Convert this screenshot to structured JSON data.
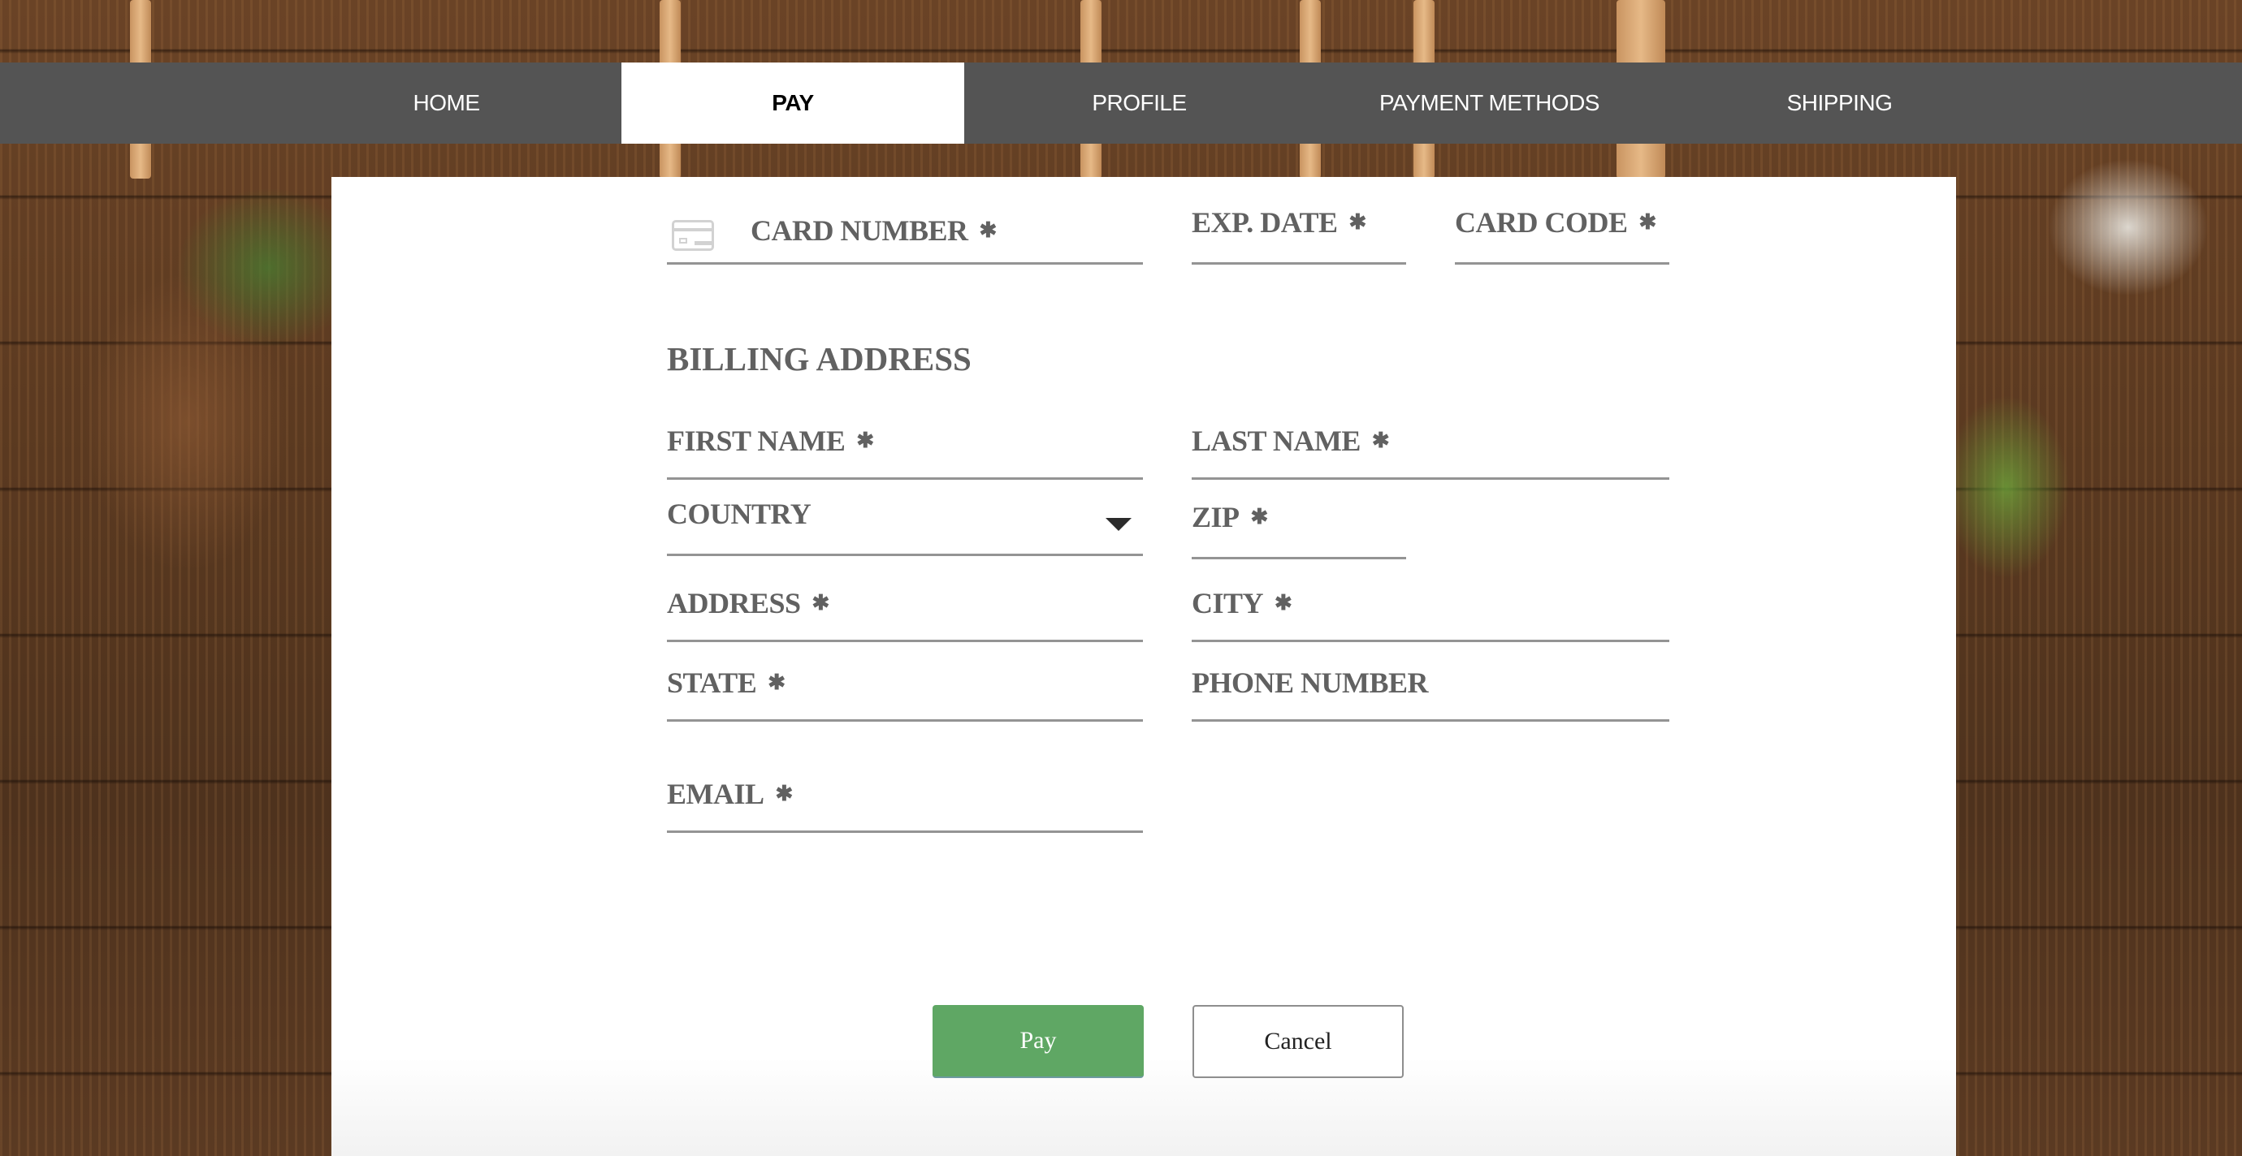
{
  "nav": {
    "items": [
      {
        "label": "HOME",
        "active": false
      },
      {
        "label": "PAY",
        "active": true
      },
      {
        "label": "PROFILE",
        "active": false
      },
      {
        "label": "PAYMENT METHODS",
        "active": false
      },
      {
        "label": "SHIPPING",
        "active": false
      }
    ]
  },
  "payment": {
    "card_number": {
      "label": "CARD NUMBER",
      "required": "✱",
      "value": ""
    },
    "exp_date": {
      "label": "EXP. DATE",
      "required": "✱",
      "value": ""
    },
    "card_code": {
      "label": "CARD CODE",
      "required": "✱",
      "value": ""
    }
  },
  "billing": {
    "title": "BILLING ADDRESS",
    "first_name": {
      "label": "FIRST NAME",
      "required": "✱",
      "value": ""
    },
    "last_name": {
      "label": "LAST NAME",
      "required": "✱",
      "value": ""
    },
    "country": {
      "label": "COUNTRY",
      "value": ""
    },
    "zip": {
      "label": "ZIP",
      "required": "✱",
      "value": ""
    },
    "address": {
      "label": "ADDRESS",
      "required": "✱",
      "value": ""
    },
    "city": {
      "label": "CITY",
      "required": "✱",
      "value": ""
    },
    "state": {
      "label": "STATE",
      "required": "✱",
      "value": ""
    },
    "phone": {
      "label": "PHONE NUMBER",
      "value": ""
    },
    "email": {
      "label": "EMAIL",
      "required": "✱",
      "value": ""
    }
  },
  "actions": {
    "pay_label": "Pay",
    "cancel_label": "Cancel"
  },
  "colors": {
    "nav_bg": "#545454",
    "nav_active_bg": "#ffffff",
    "pay_button": "#5fa764",
    "label_text": "#616161",
    "field_underline": "#949494"
  }
}
